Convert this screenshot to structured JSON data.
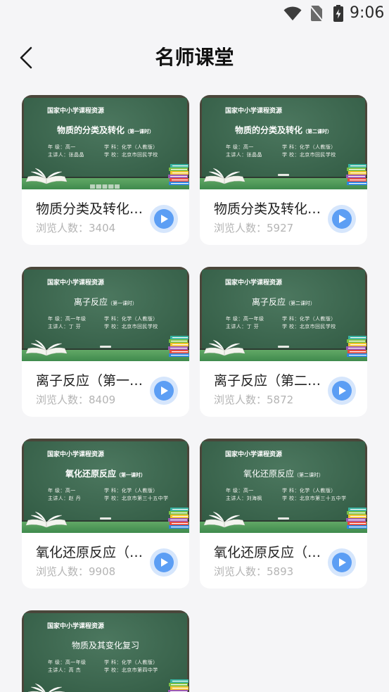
{
  "status_bar": {
    "time": "9:06",
    "icons": {
      "wifi": "wifi-icon",
      "sim": "no-sim-icon",
      "battery": "battery-charging-icon"
    }
  },
  "header": {
    "back_icon": "chevron-left-icon",
    "title": "名师课堂"
  },
  "labels": {
    "banner": "国家中小学课程资源",
    "grade": "年 级：",
    "subject": "学 科：",
    "teacher": "主讲人：",
    "school": "学 校：",
    "views": "浏览人数："
  },
  "colors": {
    "page_bg": "#f5f5f7",
    "card_bg": "#ffffff",
    "board_green": "#3a6a4f",
    "play_blue": "#5c9ef4",
    "play_halo": "#d6e6fc",
    "title_text": "#222222",
    "muted_text": "#b4b4b4"
  },
  "courses": [
    {
      "thumb_title": "物质的分类及转化",
      "thumb_session": "（第一课时）",
      "grade": "高一",
      "subject": "化学（人教版）",
      "teacher": "张晶晶",
      "school": "北京市回民学校",
      "title": "物质分类及转化…",
      "views": "3404",
      "action_icon": "play-icon"
    },
    {
      "thumb_title": "物质的分类及转化",
      "thumb_session": "（第二课时）",
      "grade": "高一",
      "subject": "化学（人教版）",
      "teacher": "张晶晶",
      "school": "北京市回民学校",
      "title": "物质分类及转化…",
      "views": "5927",
      "action_icon": "play-icon"
    },
    {
      "thumb_title": "离子反应",
      "thumb_session": "（第一课时）",
      "grade": "高一年级",
      "subject": "化学（人教版）",
      "teacher": "丁 芬",
      "school": "北京市回民学校",
      "title": "离子反应（第一…",
      "views": "8409",
      "action_icon": "play-icon"
    },
    {
      "thumb_title": "离子反应",
      "thumb_session": "（第二课时）",
      "grade": "高一年级",
      "subject": "化学（人教版）",
      "teacher": "丁 芬",
      "school": "北京市回民学校",
      "title": "离子反应（第二…",
      "views": "5872",
      "action_icon": "play-icon"
    },
    {
      "thumb_title": "氧化还原反应",
      "thumb_session": "（第一课时）",
      "grade": "高一",
      "subject": "化学（人教版）",
      "teacher": "赵 丹",
      "school": "北京市第三十五中学",
      "title": "氧化还原反应（…",
      "views": "9908",
      "action_icon": "play-icon"
    },
    {
      "thumb_title": "氧化还原反应",
      "thumb_session": "（第二课时）",
      "grade": "高一",
      "subject": "化学（人教版）",
      "teacher": "刘海枫",
      "school": "北京市第三十五中学",
      "title": "氧化还原反应（…",
      "views": "5893",
      "action_icon": "play-icon"
    },
    {
      "thumb_title": "物质及其变化复习",
      "grade": "高一年级",
      "subject": "化学（人教版）",
      "teacher": "高 杰",
      "school": "北京市第四中学"
    }
  ]
}
